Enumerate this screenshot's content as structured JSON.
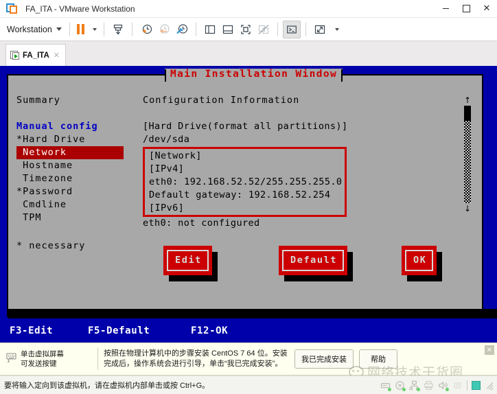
{
  "window": {
    "title": "FA_ITA - VMware Workstation",
    "logo_icon": "vmware-logo-icon",
    "minimize_label": "─",
    "maximize_label": "□",
    "close_label": "✕"
  },
  "toolbar": {
    "menu_label": "Workstation",
    "items": [
      {
        "name": "pause-button",
        "icon": "pause-icon"
      },
      {
        "name": "pause-dropdown",
        "icon": "chevron-down-icon"
      },
      {
        "name": "send-ctrl-alt-del-button",
        "icon": "send-keys-icon"
      },
      {
        "name": "take-snapshot-button",
        "icon": "snapshot-add-icon"
      },
      {
        "name": "revert-snapshot-button",
        "icon": "snapshot-revert-icon"
      },
      {
        "name": "manage-snapshots-button",
        "icon": "snapshot-manage-icon"
      },
      {
        "name": "show-library-button",
        "icon": "sidebar-left-icon"
      },
      {
        "name": "show-thumbnails-button",
        "icon": "panel-bottom-icon"
      },
      {
        "name": "full-screen-button",
        "icon": "fullscreen-brackets-icon"
      },
      {
        "name": "unity-mode-button",
        "icon": "unity-disabled-icon"
      },
      {
        "name": "console-view-button",
        "icon": "terminal-icon"
      },
      {
        "name": "stretch-view-button",
        "icon": "expand-arrows-icon"
      },
      {
        "name": "stretch-dropdown",
        "icon": "chevron-down-icon"
      }
    ]
  },
  "tab": {
    "label": "FA_ITA",
    "icon": "vm-running-icon",
    "close_label": "✕"
  },
  "vm": {
    "dialog_title": "Main Installation Window",
    "summary": {
      "heading": "Summary",
      "items": [
        {
          "label": "Manual config",
          "style": "blue"
        },
        {
          "label": "*Hard Drive",
          "style": "normal"
        },
        {
          "label": " Network",
          "style": "selected"
        },
        {
          "label": " Hostname",
          "style": "normal"
        },
        {
          "label": " Timezone",
          "style": "normal"
        },
        {
          "label": "*Password",
          "style": "normal"
        },
        {
          "label": " Cmdline",
          "style": "normal"
        },
        {
          "label": " TPM",
          "style": "normal"
        }
      ],
      "footnote": "* necessary"
    },
    "config": {
      "heading": "Configuration Information",
      "lines_top": [
        "[Hard Drive(format all partitions)]",
        "/dev/sda"
      ],
      "network_box": [
        "[Network]",
        "[IPv4]",
        "eth0: 192.168.52.52/255.255.255.0",
        "Default gateway: 192.168.52.254",
        "[IPv6]"
      ],
      "lines_bottom": [
        "eth0: not configured"
      ]
    },
    "scrollbar": {
      "up_arrow": "↑",
      "down_arrow": "↓"
    },
    "buttons": [
      {
        "name": "edit-button",
        "label": "Edit"
      },
      {
        "name": "default-button",
        "label": "Default"
      },
      {
        "name": "ok-button",
        "label": "OK"
      }
    ],
    "shortcuts": [
      "F3-Edit",
      "F5-Default",
      "F12-OK"
    ]
  },
  "notice": {
    "keyboard_icon": "keyboard-icon",
    "hint_line1": "单击虚拟屏幕",
    "hint_line2": "可发送按键",
    "message": "按照在物理计算机中的步骤安装 CentOS 7 64 位。安装完成后，操作系统会进行引导，单击“我已完成安装”。",
    "primary_button": "我已完成安装",
    "secondary_button": "帮助",
    "close_label": "✕"
  },
  "watermark": {
    "icon": "wechat-icon",
    "text": "网络技术干货圈"
  },
  "statusbar": {
    "text": "要将输入定向到该虚拟机，请在虚拟机内部单击或按 Ctrl+G。",
    "icons": [
      {
        "name": "hard-disk-status-icon"
      },
      {
        "name": "cd-drive-status-icon"
      },
      {
        "name": "network-adapter-status-icon"
      },
      {
        "name": "printer-status-icon"
      },
      {
        "name": "sound-card-status-icon"
      },
      {
        "name": "usb-device-status-icon"
      }
    ]
  },
  "colors": {
    "vm_blue": "#0000aa",
    "dialog_gray": "#a8a8a8",
    "accent_red": "#cc0000",
    "selection_red": "#aa0000",
    "menu_blue": "#0000c4",
    "brand_orange": "#f07e1a",
    "brand_blue": "#2a8fd4"
  }
}
